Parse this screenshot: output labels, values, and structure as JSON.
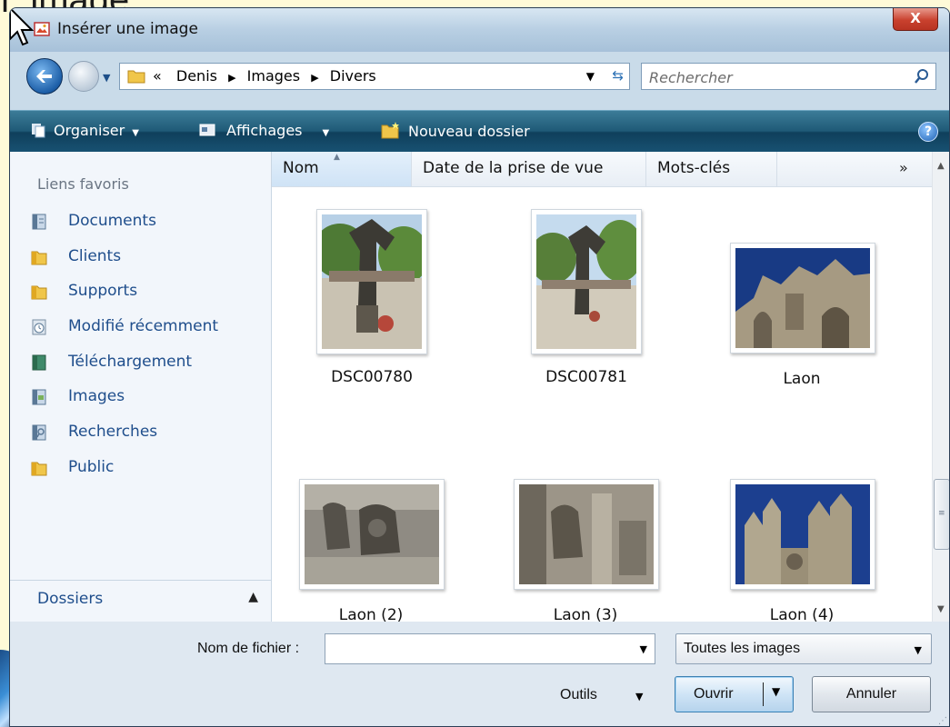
{
  "background": {
    "partial_heading": "ı, image."
  },
  "window": {
    "title": "Insérer une image",
    "close_label": "X"
  },
  "address": {
    "crumbs": [
      "«",
      "Denis",
      "Images",
      "Divers"
    ],
    "search_placeholder": "Rechercher"
  },
  "toolbar": {
    "organize": "Organiser",
    "views": "Affichages",
    "new_folder": "Nouveau dossier",
    "help": "?"
  },
  "nav": {
    "header": "Liens favoris",
    "items": [
      {
        "label": "Documents",
        "icon": "documents-icon"
      },
      {
        "label": "Clients",
        "icon": "folder-icon"
      },
      {
        "label": "Supports",
        "icon": "folder-icon"
      },
      {
        "label": "Modifié récemment",
        "icon": "recent-icon"
      },
      {
        "label": "Téléchargement",
        "icon": "download-icon"
      },
      {
        "label": "Images",
        "icon": "pictures-icon"
      },
      {
        "label": "Recherches",
        "icon": "searches-icon"
      },
      {
        "label": "Public",
        "icon": "folder-icon"
      }
    ],
    "folders_label": "Dossiers",
    "folders_chevron": "^"
  },
  "columns": [
    "Nom",
    "Date de la prise de vue",
    "Mots-clés"
  ],
  "columns_more": "»",
  "files": [
    {
      "name": "DSC00780",
      "kind": "statue-photo"
    },
    {
      "name": "DSC00781",
      "kind": "statue-photo"
    },
    {
      "name": "Laon",
      "kind": "cathedral-photo"
    },
    {
      "name": "Laon (2)",
      "kind": "gargoyle-photo"
    },
    {
      "name": "Laon (3)",
      "kind": "carving-photo"
    },
    {
      "name": "Laon (4)",
      "kind": "cathedral-photo"
    }
  ],
  "bottom": {
    "filename_label": "Nom de fichier :",
    "filename_value": "",
    "filetype": "Toutes les images",
    "tools": "Outils",
    "open": "Ouvrir",
    "cancel": "Annuler"
  }
}
